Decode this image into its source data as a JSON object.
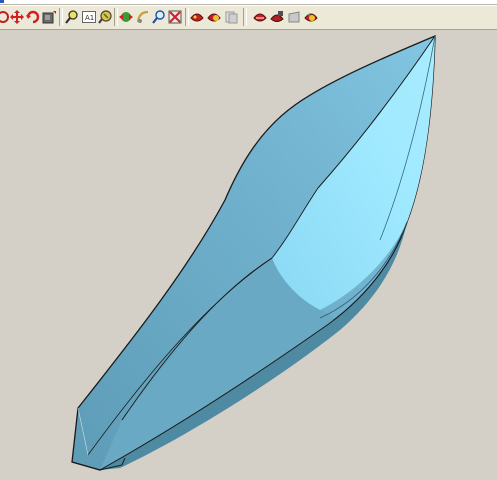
{
  "toolbar": {
    "buttons": [
      {
        "id": "orbit",
        "icon": "orbit-icon"
      },
      {
        "id": "pan",
        "icon": "pan-arrows-icon"
      },
      {
        "id": "rotate",
        "icon": "rotate-icon"
      },
      {
        "id": "section",
        "icon": "section-cube-icon"
      },
      {
        "id": "zoom-window",
        "icon": "zoom-window-icon"
      },
      {
        "id": "zoom-annotation",
        "icon": "zoom-annotation-icon"
      },
      {
        "id": "zoom-dynamic",
        "icon": "zoom-dynamic-icon"
      },
      {
        "id": "shade-view",
        "icon": "shade-view-icon"
      },
      {
        "id": "look-at",
        "icon": "look-at-icon"
      },
      {
        "id": "magnify",
        "icon": "magnify-icon"
      },
      {
        "id": "fit-all",
        "icon": "fit-all-icon"
      },
      {
        "id": "render-1",
        "icon": "render-icon"
      },
      {
        "id": "render-2",
        "icon": "render-shaded-icon"
      },
      {
        "id": "render-3",
        "icon": "render-disabled-icon"
      },
      {
        "id": "render-4",
        "icon": "render-part-icon"
      },
      {
        "id": "render-5",
        "icon": "render-edges-icon"
      },
      {
        "id": "render-6",
        "icon": "render-hidden-icon"
      },
      {
        "id": "render-7",
        "icon": "render-material-icon"
      }
    ]
  },
  "viewport": {
    "model": "hull-surface",
    "background_color": "#d4d0c8",
    "surface_colors": {
      "light": "#9fe8ff",
      "mid": "#7fc3e0",
      "dark": "#5f9db8",
      "edge": "#1a1a1a"
    }
  }
}
